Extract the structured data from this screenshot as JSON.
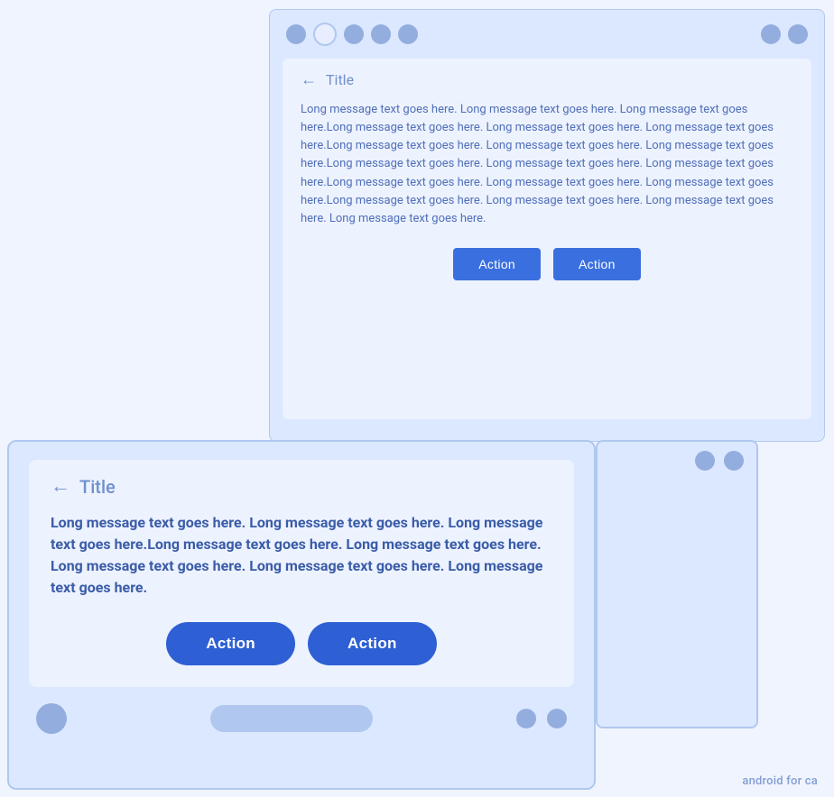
{
  "phone_top": {
    "status_bar": {
      "left_dots": [
        "sm",
        "white",
        "sm",
        "sm",
        "sm"
      ],
      "right_dots": [
        "sm",
        "sm"
      ]
    },
    "title": "Title",
    "message": "Long message text goes here. Long message text goes here. Long message text goes here.Long message text goes here. Long message text goes here. Long message text goes here.Long message text goes here. Long message text goes here. Long message text goes here.Long message text goes here. Long message text goes here. Long message text goes here.Long message text goes here. Long message text goes here. Long message text goes here.Long message text goes here. Long message text goes here. Long message text goes here. Long message text goes here.",
    "button1": "Action",
    "button2": "Action"
  },
  "phone_bottom": {
    "title": "Title",
    "message": "Long message text goes here. Long message text goes here. Long message text goes here.Long message text goes here. Long message text goes here. Long message text goes here. Long message text goes here. Long message text goes here.",
    "button1": "Action",
    "button2": "Action"
  },
  "watermark": "android for ca"
}
